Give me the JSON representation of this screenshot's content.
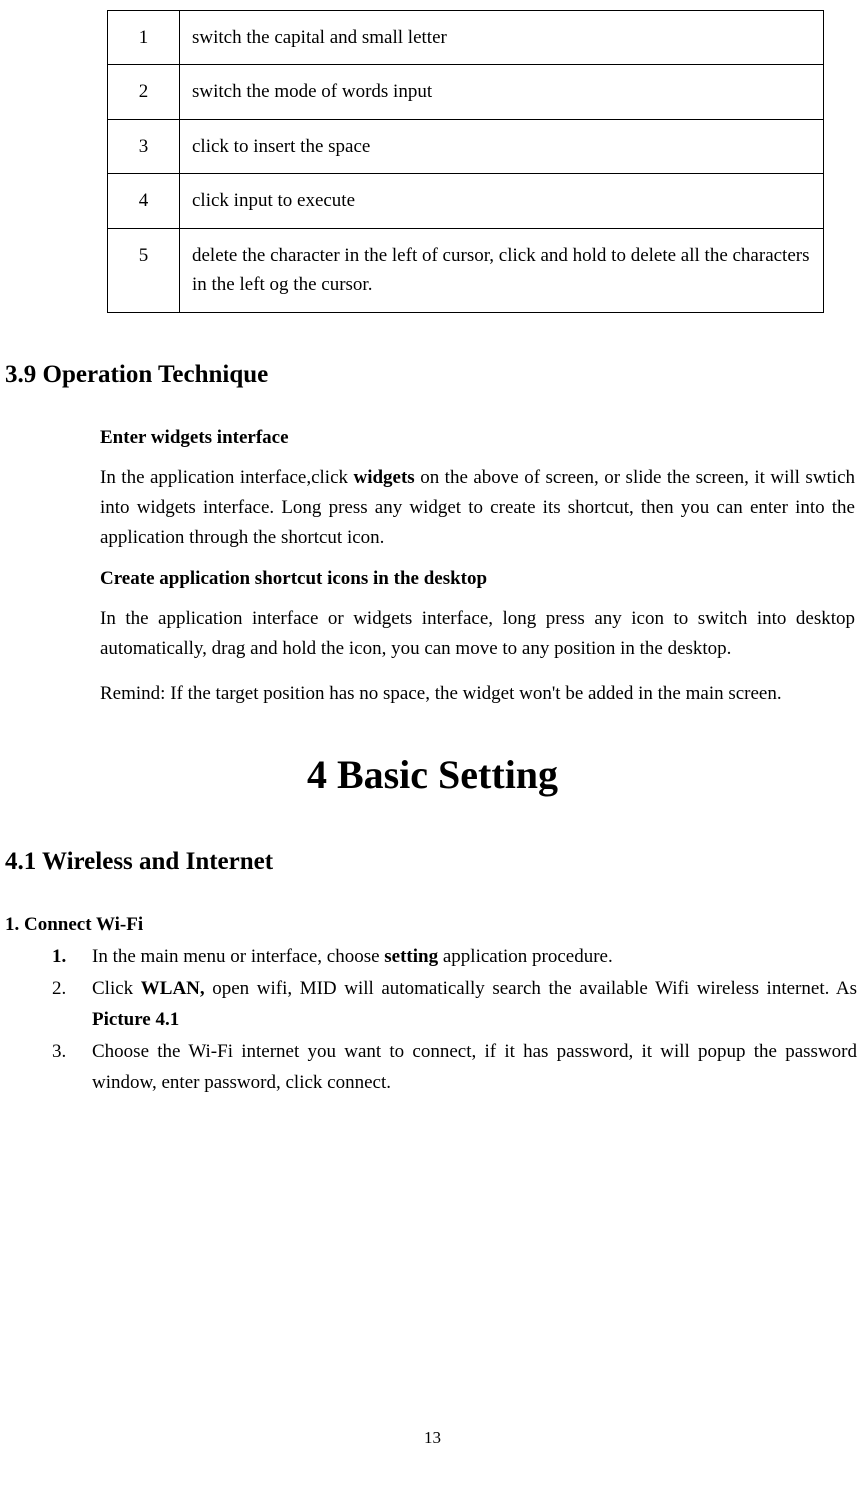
{
  "table": {
    "rows": [
      {
        "num": "1",
        "desc": "switch the capital and small letter"
      },
      {
        "num": "2",
        "desc": "switch the mode of words input"
      },
      {
        "num": "3",
        "desc": "click to insert the space"
      },
      {
        "num": "4",
        "desc": "click input to execute"
      },
      {
        "num": "5",
        "desc": "delete the character in the left of cursor, click and hold to delete all the characters in the left og the cursor."
      }
    ]
  },
  "section39": {
    "heading": "3.9 Operation Technique",
    "sub1_head": "Enter widgets interface",
    "sub1_para_pre": "In the application interface,click ",
    "sub1_para_bold": "widgets",
    "sub1_para_post": " on the above of screen, or slide the screen, it will swtich into widgets interface. Long press any widget to create its shortcut, then you can enter into the application through the shortcut icon.",
    "sub2_head": "Create application shortcut icons in the desktop",
    "sub2_para": "In the application interface or widgets interface, long press any icon to switch into desktop automatically, drag and hold the icon, you can move to any position in the desktop.",
    "sub2_remind": "Remind: If the target position has no space, the widget won't be added in the main screen."
  },
  "chapter4": {
    "title": "4 Basic Setting"
  },
  "section41": {
    "heading": "4.1 Wireless and Internet",
    "sub_head": "1. Connect Wi-Fi",
    "items": [
      {
        "marker_bold": true,
        "marker": "1.",
        "pre": "In the main menu or interface, choose ",
        "bold1": "setting",
        "mid": " application procedure.",
        "bold2": "",
        "post": ""
      },
      {
        "marker_bold": false,
        "marker": "2.",
        "pre": "Click ",
        "bold1": "WLAN,",
        "mid": " open wifi, MID will automatically search the available Wifi wireless internet. As ",
        "bold2": "Picture 4.1",
        "post": ""
      },
      {
        "marker_bold": false,
        "marker": "3.",
        "pre": "Choose the Wi-Fi internet you want to connect, if it has password, it will popup the password window, enter password, click connect.",
        "bold1": "",
        "mid": "",
        "bold2": "",
        "post": ""
      }
    ]
  },
  "page_number": "13"
}
